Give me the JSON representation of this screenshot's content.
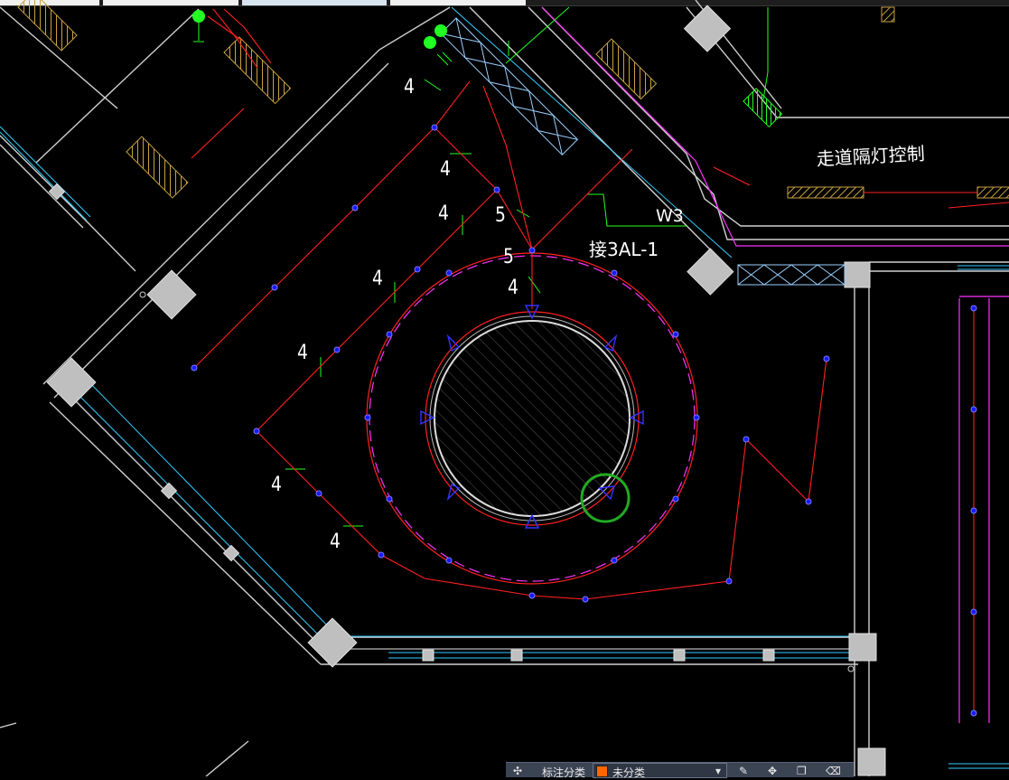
{
  "drawing": {
    "circuit_numbers": [
      "4",
      "4",
      "4",
      "5",
      "5",
      "4",
      "4",
      "4",
      "4",
      "4"
    ],
    "circuit_code": "W3",
    "panel_connection": "接3AL-1",
    "corridor_note": "走道隔灯控制"
  },
  "toolbar": {
    "field_label": "标注分类",
    "selected_category": "未分类"
  },
  "colors": {
    "background": "#000000",
    "wiring": "#ff2020",
    "fixture": "#3333ff",
    "wall": "#ffffff",
    "window": "#33ccff",
    "boundary": "#ff33ff",
    "highlight": "#22aa22"
  }
}
